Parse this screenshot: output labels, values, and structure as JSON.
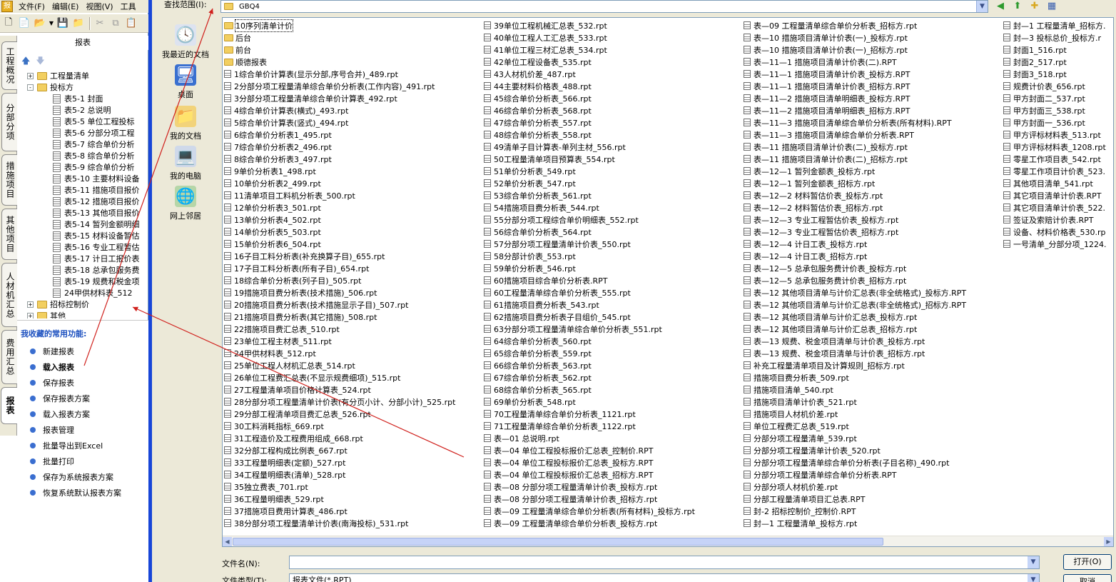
{
  "menubar": {
    "items": [
      "文件(F)",
      "编辑(E)",
      "视图(V)",
      "工具"
    ]
  },
  "panel": {
    "title": "报表"
  },
  "vtabs": [
    "工程概况",
    "分部分项",
    "措施项目",
    "其他项目",
    "人材机汇总",
    "费用汇总",
    "报表"
  ],
  "tree": [
    {
      "label": "工程量清单",
      "type": "folder",
      "level": 0,
      "exp": "+"
    },
    {
      "label": "投标方",
      "type": "folder",
      "level": 0,
      "exp": "-"
    },
    {
      "label": "表5-1 封面",
      "type": "doc",
      "level": 1
    },
    {
      "label": "表5-2 总说明",
      "type": "doc",
      "level": 1
    },
    {
      "label": "表5-5 单位工程投标",
      "type": "doc",
      "level": 1
    },
    {
      "label": "表5-6 分部分项工程",
      "type": "doc",
      "level": 1
    },
    {
      "label": "表5-7 综合单价分析",
      "type": "doc",
      "level": 1
    },
    {
      "label": "表5-8 综合单价分析",
      "type": "doc",
      "level": 1
    },
    {
      "label": "表5-9 综合单价分析",
      "type": "doc",
      "level": 1
    },
    {
      "label": "表5-10 主要材料设备",
      "type": "doc",
      "level": 1
    },
    {
      "label": "表5-11 措施项目报价",
      "type": "doc",
      "level": 1
    },
    {
      "label": "表5-12 措施项目报价",
      "type": "doc",
      "level": 1
    },
    {
      "label": "表5-13 其他项目报价",
      "type": "doc",
      "level": 1
    },
    {
      "label": "表5-14 暂列金额明细",
      "type": "doc",
      "level": 1
    },
    {
      "label": "表5-15 材料设备暂估",
      "type": "doc",
      "level": 1
    },
    {
      "label": "表5-16 专业工程暂估",
      "type": "doc",
      "level": 1
    },
    {
      "label": "表5-17 计日工报价表",
      "type": "doc",
      "level": 1
    },
    {
      "label": "表5-18 总承包服务费",
      "type": "doc",
      "level": 1
    },
    {
      "label": "表5-19 规费和税金项",
      "type": "doc",
      "level": 1
    },
    {
      "label": "24甲供材料表_512",
      "type": "doc",
      "level": 1
    },
    {
      "label": "招标控制价",
      "type": "folder",
      "level": 0,
      "exp": "+"
    },
    {
      "label": "其他",
      "type": "folder",
      "level": 0,
      "exp": "+"
    }
  ],
  "favorites": {
    "title": "我收藏的常用功能:",
    "items": [
      "新建报表",
      "载入报表",
      "保存报表",
      "保存报表方案",
      "载入报表方案",
      "报表管理",
      "批量导出到Excel",
      "批量打印",
      "保存为系统报表方案",
      "恢复系统默认报表方案"
    ]
  },
  "dialog": {
    "lookin_label": "查找范围(I):",
    "lookin_value": "GBQ4",
    "places": [
      "我最近的文档",
      "桌面",
      "我的文档",
      "我的电脑",
      "网上邻居"
    ],
    "filename_label": "文件名(N):",
    "filename_value": "",
    "filetype_label": "文件类型(T):",
    "filetype_value": "报表文件(*.RPT)",
    "open_button": "打开(O)",
    "cancel_button": "取消"
  },
  "files": {
    "col1": [
      "10序列清单计价",
      "后台",
      "前台",
      "顺德报表",
      "1综合单价计算表(显示分部,序号合并)_489.rpt",
      "2分部分项工程量清单综合单价分析表(工作内容)_491.rpt",
      "3分部分项工程量清单综合单价计算表_492.rpt",
      "4综合单价计算表(横式)_493.rpt",
      "5综合单价计算表(竖式)_494.rpt",
      "6综合单价分析表1_495.rpt",
      "7综合单价分析表2_496.rpt",
      "8综合单价分析表3_497.rpt",
      "9单价分析表1_498.rpt",
      "10单价分析表2_499.rpt",
      "11清单项目工料机分析表_500.rpt",
      "12单价分析表3_501.rpt",
      "13单价分析表4_502.rpt",
      "14单价分析表5_503.rpt",
      "15单价分析表6_504.rpt",
      "16子目工料分析表(补充换算子目)_655.rpt",
      "17子目工料分析表(所有子目)_654.rpt",
      "18综合单价分析表(列子目)_505.rpt",
      "19措施项目费分析表(技术措施)_506.rpt",
      "20措施项目费分析表(技术措施显示子目)_507.rpt",
      "21措施项目费分析表(其它措施)_508.rpt",
      "22措施项目费汇总表_510.rpt",
      "23单位工程主材表_511.rpt",
      "24甲供材料表_512.rpt",
      "25单位工程人材机汇总表_514.rpt",
      "26单位工程费汇总表(不显示规费细项)_515.rpt",
      "27工程量清单项目价格计算表_524.rpt",
      "28分部分项工程量清单计价表(有分页小计、分部小计)_525.rpt",
      "29分部工程清单项目费汇总表_526.rpt",
      "30工料消耗指标_669.rpt",
      "31工程造价及工程费用组成_668.rpt",
      "32分部工程构成比例表_667.rpt",
      "33工程量明细表(定额)_527.rpt",
      "34工程量明细表(清单)_528.rpt",
      "35独立费表_701.rpt",
      "36工程量明细表_529.rpt",
      "37措施项目费用计算表_486.rpt",
      "38分部分项工程量清单计价表(南海投标)_531.rpt"
    ],
    "col2": [
      "39单位工程机械汇总表_532.rpt",
      "40单位工程人工汇总表_533.rpt",
      "41单位工程三材汇总表_534.rpt",
      "42单位工程设备表_535.rpt",
      "43人材机价差_487.rpt",
      "44主要材料价格表_488.rpt",
      "45综合单价分析表_566.rpt",
      "46综合单价分析表_568.rpt",
      "47综合单价分析表_557.rpt",
      "48综合单价分析表_558.rpt",
      "49清单子目计算表-单列主材_556.rpt",
      "50工程量清单项目预算表_554.rpt",
      "51单价分析表_549.rpt",
      "52单价分析表_547.rpt",
      "53综合单价分析表_561.rpt",
      "54措施项目费分析表_544.rpt",
      "55分部分项工程综合单价明细表_552.rpt",
      "56综合单价分析表_564.rpt",
      "57分部分项工程量清单计价表_550.rpt",
      "58分部计价表_553.rpt",
      "59单价分析表_546.rpt",
      "60措施项目综合单价分析表.RPT",
      "60工程量清单综合单价分析表_555.rpt",
      "61措施项目费分析表_543.rpt",
      "62措施项目费分析表子目组价_545.rpt",
      "63分部分项工程量清单综合单价分析表_551.rpt",
      "64综合单价分析表_560.rpt",
      "65综合单价分析表_559.rpt",
      "66综合单价分析表_563.rpt",
      "67综合单价分析表_562.rpt",
      "68综合单价分析表_565.rpt",
      "69单价分析表_548.rpt",
      "70工程量清单综合单价分析表_1121.rpt",
      "71工程量清单综合单价分析表_1122.rpt",
      "表—01 总说明.rpt",
      "表—04 单位工程投标报价汇总表_控制价.RPT",
      "表—04 单位工程投标报价汇总表_投标方.RPT",
      "表—04 单位工程投标报价汇总表_招标方.RPT",
      "表—08 分部分项工程量清单计价表_投标方.rpt",
      "表—08 分部分项工程量清单计价表_招标方.rpt",
      "表—09 工程量清单综合单价分析表(所有材料)_投标方.rpt",
      "表—09 工程量清单综合单价分析表_投标方.rpt"
    ],
    "col3": [
      "表—09 工程量清单综合单价分析表_招标方.rpt",
      "表—10 措施项目清单计价表(一)_投标方.rpt",
      "表—10 措施项目清单计价表(一)_招标方.rpt",
      "表—11—1 措施项目清单计价表(二).RPT",
      "表—11—1 措施项目清单计价表_投标方.RPT",
      "表—11—1 措施项目清单计价表_招标方.RPT",
      "表—11—2 措施项目清单明细表_投标方.RPT",
      "表—11—2 措施项目清单明细表_招标方.RPT",
      "表—11—3 措施项目清单综合单价分析表(所有材料).RPT",
      "表—11—3 措施项目清单综合单价分析表.RPT",
      "表—11 措施项目清单计价表(二)_投标方.rpt",
      "表—11 措施项目清单计价表(二)_招标方.rpt",
      "表—12—1 暂列金额表_投标方.rpt",
      "表—12—1 暂列金额表_招标方.rpt",
      "表—12—2 材料暂估价表_投标方.rpt",
      "表—12—2 材料暂估价表_招标方.rpt",
      "表—12—3 专业工程暂估价表_投标方.rpt",
      "表—12—3 专业工程暂估价表_招标方.rpt",
      "表—12—4 计日工表_投标方.rpt",
      "表—12—4 计日工表_招标方.rpt",
      "表—12—5 总承包服务费计价表_投标方.rpt",
      "表—12—5 总承包服务费计价表_招标方.rpt",
      "表—12 其他项目清单与计价汇总表(非全统格式)_投标方.RPT",
      "表—12 其他项目清单与计价汇总表(非全统格式)_招标方.RPT",
      "表—12 其他项目清单与计价汇总表_投标方.rpt",
      "表—12 其他项目清单与计价汇总表_招标方.rpt",
      "表—13 规费、税金项目清单与计价表_投标方.rpt",
      "表—13 规费、税金项目清单与计价表_招标方.rpt",
      "补充工程量清单项目及计算规则_招标方.rpt",
      "措施项目费分析表_509.rpt",
      "措施项目清单_540.rpt",
      "措施项目清单计价表_521.rpt",
      "措施项目人材机价差.rpt",
      "单位工程费汇总表_519.rpt",
      "分部分项工程量清单_539.rpt",
      "分部分项工程量清单计价表_520.rpt",
      "分部分项工程量清单综合单价分析表(子目名称)_490.rpt",
      "分部分项工程量清单综合单价分析表.RPT",
      "分部分项人材机价差.rpt",
      "分部工程量清单项目汇总表.RPT",
      "封-2 招标控制价_控制价.RPT",
      "封—1 工程量清单_投标方.rpt"
    ],
    "col4": [
      "封—1 工程量清单_招标方.",
      "封—3 投标总价_投标方.r",
      "封面1_516.rpt",
      "封面2_517.rpt",
      "封面3_518.rpt",
      "规费计价表_656.rpt",
      "甲方封面二_537.rpt",
      "甲方封面三_538.rpt",
      "甲方封面一_536.rpt",
      "甲方评标材料表_513.rpt",
      "甲方评标材料表_1208.rpt",
      "零星工作项目表_542.rpt",
      "零星工作项目计价表_523.",
      "其他项目清单_541.rpt",
      "其它项目清单计价表.RPT",
      "其它项目清单计价表_522.",
      "签证及索赔计价表.RPT",
      "设备、材料价格表_530.rp",
      "一号清单_分部分项_1224."
    ]
  }
}
